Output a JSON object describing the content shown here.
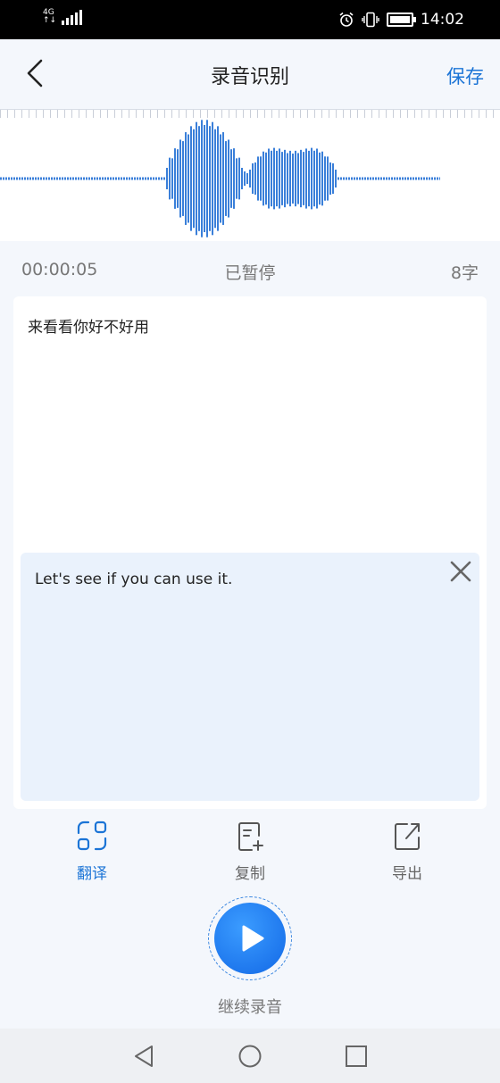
{
  "status_bar": {
    "time": "14:02",
    "network": "4G",
    "icons": [
      "signal-icon",
      "alarm-icon",
      "vibrate-icon",
      "battery-icon"
    ]
  },
  "header": {
    "title": "录音识别",
    "save_label": "保存",
    "back_icon": "chevron-left-icon"
  },
  "recording": {
    "elapsed": "00:00:05",
    "state": "已暂停",
    "char_count": "8字"
  },
  "content": {
    "recognized_text": "来看看你好不好用",
    "translation_text": "Let's see if you can use it."
  },
  "actions": [
    {
      "label": "翻译",
      "icon": "translate-scan-icon",
      "active": true
    },
    {
      "label": "复制",
      "icon": "copy-document-icon",
      "active": false
    },
    {
      "label": "导出",
      "icon": "export-icon",
      "active": false
    }
  ],
  "record_button": {
    "label": "继续录音",
    "icon": "play-icon"
  },
  "colors": {
    "accent": "#1b74d6",
    "wave": "#3a7fd9",
    "background": "#f4f7fc",
    "translation_bg": "#eaf2fc"
  },
  "nav_icons": [
    "nav-back-icon",
    "nav-home-icon",
    "nav-recents-icon"
  ]
}
